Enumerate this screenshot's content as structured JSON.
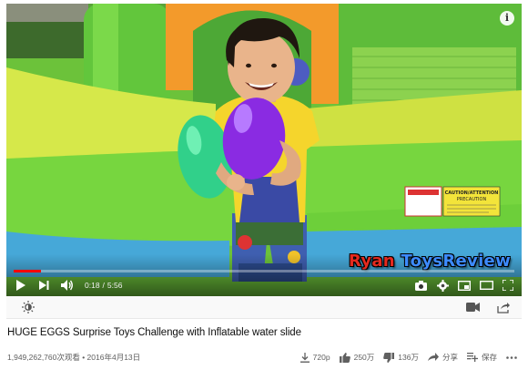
{
  "video": {
    "watermark_part1": "Ryan ",
    "watermark_part2": "ToysReview",
    "sign_title": "CAUTION/ATTENTION",
    "sign_subtitle": "PRECAUTION",
    "progress": 0.0537,
    "info_symbol": "i"
  },
  "player": {
    "time_current": "0:18",
    "time_separator": "/",
    "time_total": "5:56",
    "controls_left": [
      "play-icon",
      "next-icon",
      "volume-icon"
    ],
    "controls_right": [
      "autoplay-toggle",
      "settings-icon",
      "miniplayer-icon",
      "theater-icon",
      "fullscreen-icon"
    ]
  },
  "toolbar_strip": {
    "left_icon": "brightness-icon",
    "right_icons": [
      "camera-icon",
      "share-arrow-icon"
    ]
  },
  "video_meta": {
    "title": "HUGE EGGS Surprise Toys Challenge with Inflatable water slide",
    "views_date": "1,949,262,760次观看 • 2016年4月13日"
  },
  "actions": {
    "download_label": "720p",
    "like_count": "250万",
    "dislike_count": "136万",
    "share_label": "分享",
    "save_label": "保存",
    "more_icon": "more-horizontal-icon"
  },
  "colors": {
    "progress_red": "#ff0000",
    "watermark_red": "#e32a1f",
    "watermark_blue": "#3d8bff",
    "bouncy_green": "#6cc23a",
    "bouncy_yellow": "#d6e84a",
    "egg_purple": "#8a2be2",
    "egg_green": "#31d08a"
  }
}
